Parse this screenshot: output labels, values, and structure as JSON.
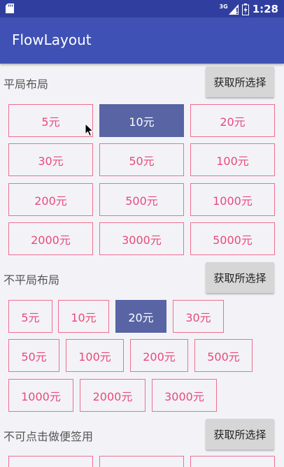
{
  "status_bar": {
    "network": "3G",
    "time": "1:28"
  },
  "app_bar": {
    "title": "FlowLayout"
  },
  "colors": {
    "primary": "#3f51b5",
    "primary_dark": "#303f9f",
    "tag_border": "#ee6e90",
    "tag_text": "#e94a7a",
    "tag_selected_bg": "#5864a3"
  },
  "sections": [
    {
      "label": "平局布局",
      "button_label": "获取所选择",
      "tags": [
        {
          "text": "5元",
          "selected": false
        },
        {
          "text": "10元",
          "selected": true
        },
        {
          "text": "20元",
          "selected": false
        },
        {
          "text": "30元",
          "selected": false
        },
        {
          "text": "50元",
          "selected": false
        },
        {
          "text": "100元",
          "selected": false
        },
        {
          "text": "200元",
          "selected": false
        },
        {
          "text": "500元",
          "selected": false
        },
        {
          "text": "1000元",
          "selected": false
        },
        {
          "text": "2000元",
          "selected": false
        },
        {
          "text": "3000元",
          "selected": false
        },
        {
          "text": "5000元",
          "selected": false
        }
      ]
    },
    {
      "label": "不平局布局",
      "button_label": "获取所选择",
      "tags": [
        {
          "text": "5元",
          "selected": false
        },
        {
          "text": "10元",
          "selected": false
        },
        {
          "text": "20元",
          "selected": true
        },
        {
          "text": "30元",
          "selected": false
        },
        {
          "text": "50元",
          "selected": false
        },
        {
          "text": "100元",
          "selected": false
        },
        {
          "text": "200元",
          "selected": false
        },
        {
          "text": "500元",
          "selected": false
        },
        {
          "text": "1000元",
          "selected": false
        },
        {
          "text": "2000元",
          "selected": false
        },
        {
          "text": "3000元",
          "selected": false
        }
      ]
    },
    {
      "label": "不可点击做便签用",
      "button_label": "获取所选择",
      "tags": []
    }
  ]
}
